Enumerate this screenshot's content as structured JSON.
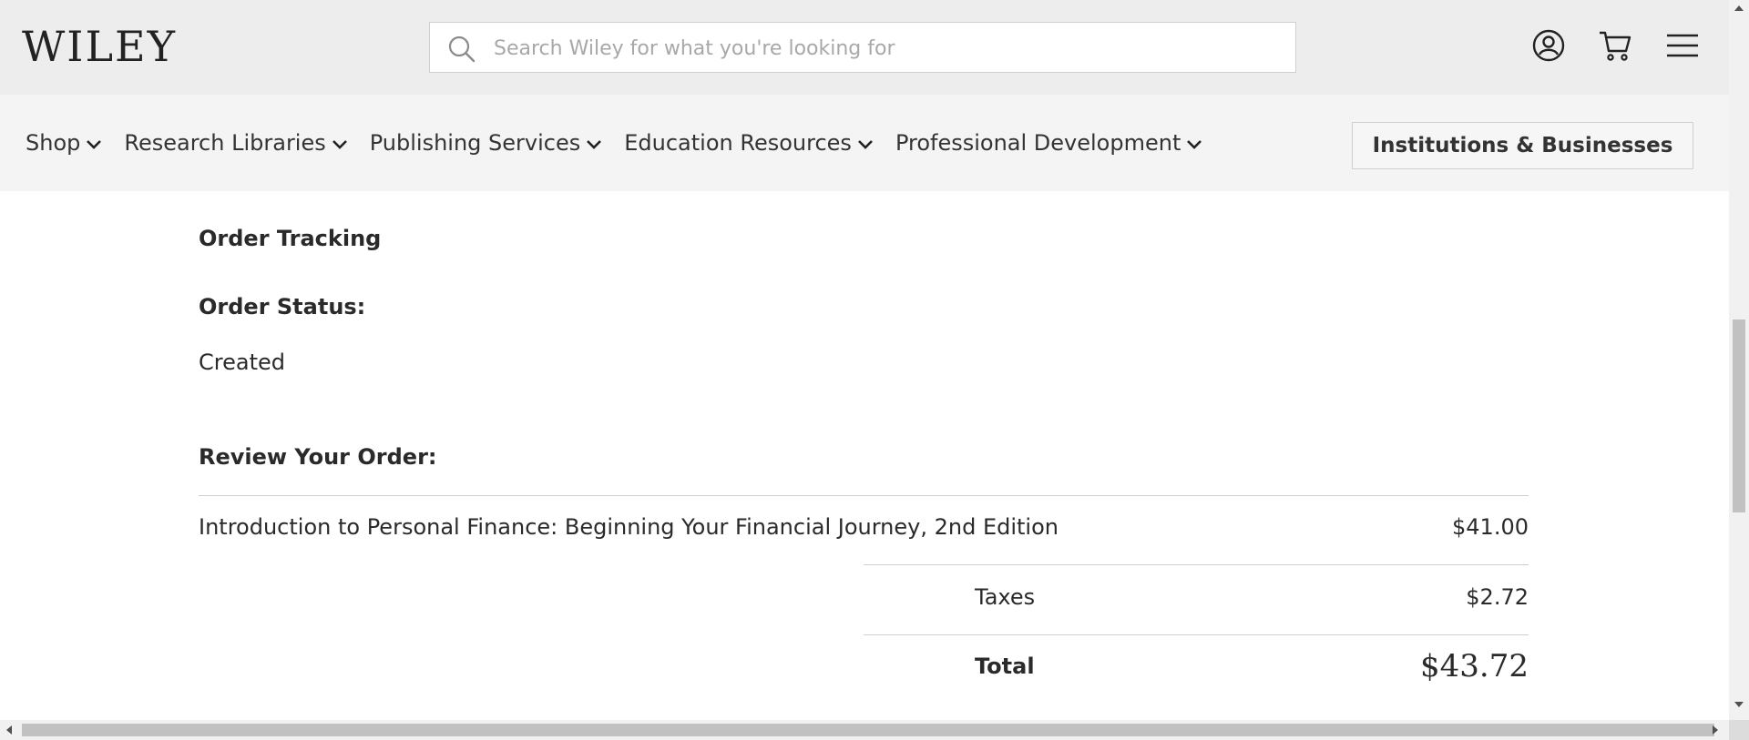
{
  "header": {
    "logo_text": "WILEY",
    "search": {
      "placeholder": "Search Wiley for what you're looking for",
      "value": ""
    },
    "icons": [
      "search-icon",
      "account-icon",
      "cart-icon",
      "menu-icon"
    ]
  },
  "nav": {
    "items": [
      {
        "label": "Shop"
      },
      {
        "label": "Research Libraries"
      },
      {
        "label": "Publishing Services"
      },
      {
        "label": "Education Resources"
      },
      {
        "label": "Professional Development"
      }
    ],
    "institutions_button": "Institutions & Businesses"
  },
  "order": {
    "tracking_heading": "Order Tracking",
    "status_heading": "Order Status:",
    "status_value": "Created",
    "review_heading": "Review Your Order:",
    "item": {
      "title": "Introduction to Personal Finance: Beginning Your Financial Journey, 2nd Edition",
      "price": "$41.00"
    },
    "taxes_label": "Taxes",
    "taxes_value": "$2.72",
    "total_label": "Total",
    "total_value": "$43.72"
  },
  "colors": {
    "header_bg": "#ededed",
    "nav_bg": "#f4f4f4",
    "text": "#2a2a2a",
    "divider": "#cfcfcf"
  }
}
